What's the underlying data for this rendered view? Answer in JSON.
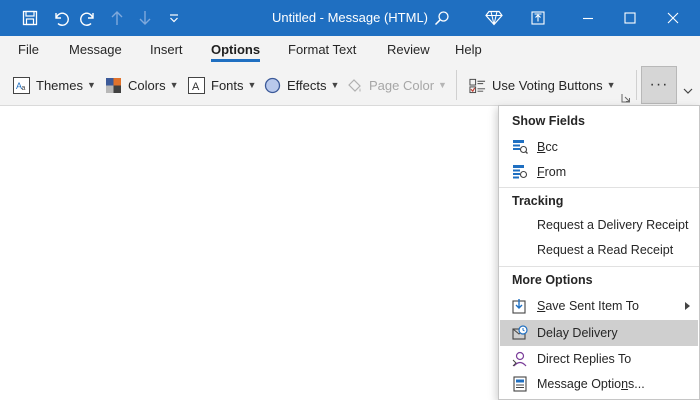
{
  "window": {
    "title": "Untitled  -  Message (HTML)",
    "accent": "#1f6fc1"
  },
  "titlebar_icons": [
    "save-icon",
    "undo-icon",
    "redo-icon",
    "up-arrow-icon",
    "down-arrow-icon",
    "customize-toolbar-icon",
    "search-icon",
    "diamond-icon",
    "restore-window-icon",
    "minimize-icon",
    "maximize-icon",
    "close-icon"
  ],
  "menu": {
    "tabs": [
      "File",
      "Message",
      "Insert",
      "Options",
      "Format Text",
      "Review",
      "Help"
    ],
    "active": "Options"
  },
  "ribbon": {
    "themes": "Themes",
    "colors": "Colors",
    "fonts": "Fonts",
    "effects": "Effects",
    "page_color": "Page Color",
    "voting": "Use Voting Buttons",
    "more": "···"
  },
  "dropdown": {
    "show_fields": "Show Fields",
    "bcc_b": "B",
    "bcc_rest": "cc",
    "from_f": "F",
    "from_rest": "rom",
    "tracking": "Tracking",
    "delivery_receipt": "Request a Delivery Receipt",
    "read_receipt": "Request a Read Receipt",
    "more_options": "More Options",
    "save_sent_s": "S",
    "save_sent_rest": "ave Sent Item To",
    "delay_delivery": "Delay Delivery",
    "direct_replies": "Direct Replies To",
    "message_options_pre": "Message Optio",
    "message_options_n": "n",
    "message_options_post": "s...",
    "hovered": "Delay Delivery"
  }
}
